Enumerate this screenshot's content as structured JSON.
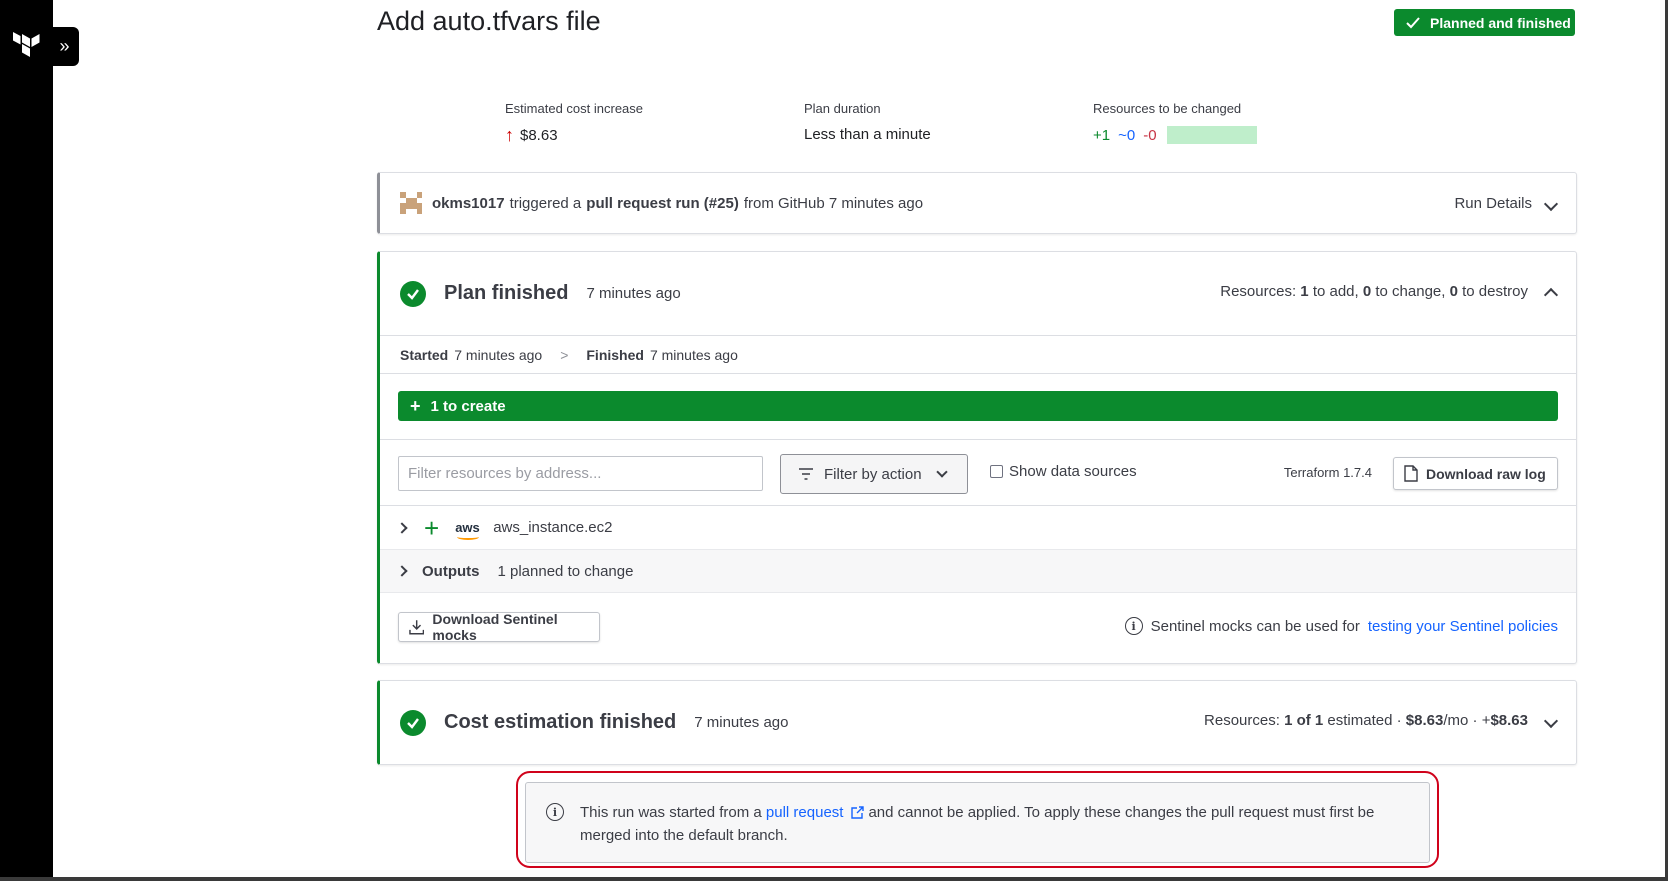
{
  "page": {
    "title": "Add auto.tfvars file",
    "status": "Planned and finished"
  },
  "metrics": {
    "cost_label": "Estimated cost increase",
    "cost_value": "$8.63",
    "duration_label": "Plan duration",
    "duration_value": "Less than a minute",
    "resources_label": "Resources to be changed",
    "add": "+1",
    "change": "~0",
    "destroy": "-0"
  },
  "trigger": {
    "user": "okms1017",
    "text1": "triggered a",
    "run": "pull request run (#25)",
    "text2": "from GitHub 7 minutes ago",
    "details_label": "Run Details"
  },
  "plan": {
    "title": "Plan finished",
    "time": "7 minutes ago",
    "res_prefix": "Resources:",
    "res_add": "1",
    "res_add_text": "to add,",
    "res_change": "0",
    "res_change_text": "to change,",
    "res_destroy": "0",
    "res_destroy_text": "to destroy",
    "started_label": "Started",
    "started_time": "7 minutes ago",
    "finished_label": "Finished",
    "finished_time": "7 minutes ago",
    "create_label": "1 to create",
    "filter_placeholder": "Filter resources by address...",
    "filter_action_label": "Filter by action",
    "show_data_sources_label": "Show data sources",
    "terraform_version": "Terraform 1.7.4",
    "download_raw_log_label": "Download raw log",
    "resource_provider": "aws",
    "resource_name": "aws_instance.ec2",
    "outputs_label": "Outputs",
    "outputs_count": "1 planned to change",
    "sentinel_button_label": "Download Sentinel mocks",
    "sentinel_text": "Sentinel mocks can be used for",
    "sentinel_link": "testing your Sentinel policies"
  },
  "cost": {
    "title": "Cost estimation finished",
    "time": "7 minutes ago",
    "res_prefix": "Resources:",
    "res_estimated": "1 of 1",
    "res_estimated_text": "estimated ·",
    "monthly": "$8.63",
    "monthly_suffix": "/mo ·",
    "delta_prefix": "+",
    "delta": "$8.63"
  },
  "notice": {
    "text1": "This run was started from a",
    "link": "pull request",
    "text2": "and cannot be applied. To apply these changes the pull request must first be merged into the default branch."
  },
  "colors": {
    "brand_green": "#0b8a2d",
    "link_blue": "#1563ff",
    "highlight_red": "#d0021b"
  }
}
